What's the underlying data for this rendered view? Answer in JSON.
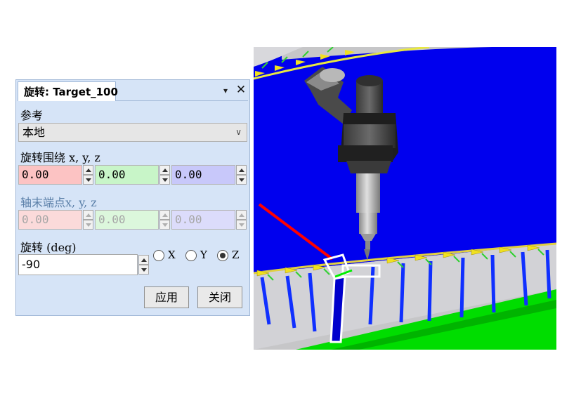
{
  "dialog": {
    "title": "旋转: Target_100",
    "pin_glyph": "▾",
    "close_glyph": "✕",
    "reference_label": "参考",
    "reference_value": "本地",
    "rotate_around_label": "旋转围绕 x, y, z",
    "rotate_around": {
      "x": "0.00",
      "y": "0.00",
      "z": "0.00"
    },
    "axis_end_label": "轴末端点x, y, z",
    "axis_end": {
      "x": "0.00",
      "y": "0.00",
      "z": "0.00"
    },
    "rotation_label": "旋转 (deg)",
    "rotation_value": "-90",
    "axes": [
      {
        "label": "X",
        "selected": false
      },
      {
        "label": "Y",
        "selected": false
      },
      {
        "label": "Z",
        "selected": true
      }
    ],
    "apply_label": "应用",
    "close_label": "关闭"
  },
  "viewport": {
    "colors": {
      "surface": "#0000ee",
      "floor": "#00dd00",
      "edge": "#ccccdd"
    }
  }
}
